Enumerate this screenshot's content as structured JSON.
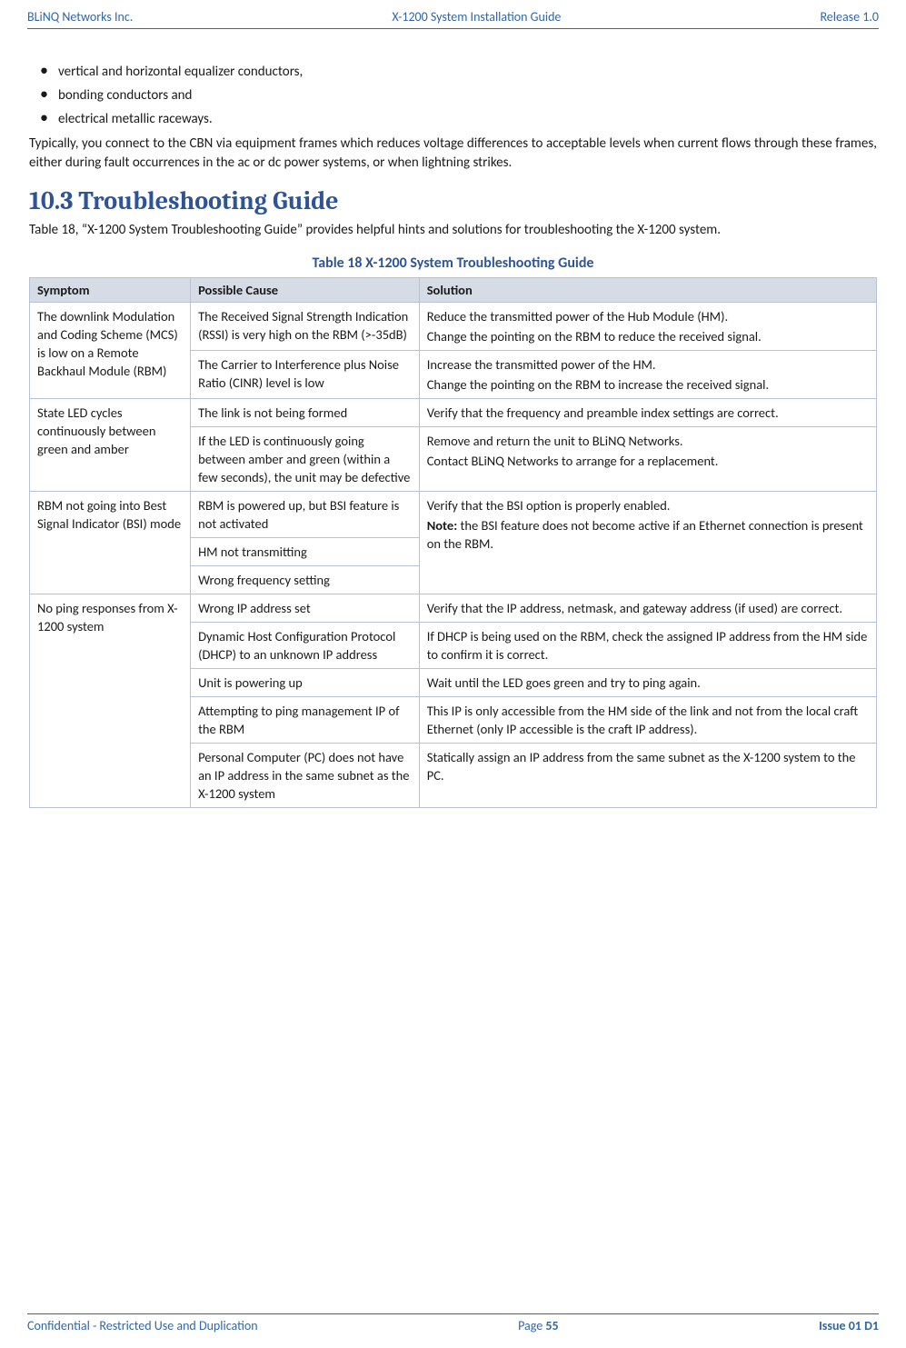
{
  "header": {
    "left": "BLiNQ Networks Inc.",
    "center": "X-1200 System Installation Guide",
    "right": "Release 1.0"
  },
  "bullets": [
    "vertical and horizontal equalizer conductors,",
    "bonding conductors and",
    "electrical metallic raceways."
  ],
  "para1": "Typically, you connect to the CBN via equipment frames which reduces voltage differences to acceptable levels when current flows through these frames, either during fault occurrences in the ac or dc power systems, or when lightning strikes.",
  "section": {
    "num": "10.3",
    "title": "Troubleshooting Guide"
  },
  "para2": "Table 18, “X-1200 System Troubleshooting Guide” provides helpful hints and solutions for troubleshooting the X-1200 system.",
  "caption": "Table 18   X-1200 System Troubleshooting Guide",
  "table": {
    "head": {
      "c1": "Symptom",
      "c2": "Possible Cause",
      "c3": "Solution"
    },
    "r0": {
      "sym": "The downlink Modulation and Coding Scheme (MCS) is low on a Remote Backhaul Module (RBM)",
      "cause": "The Received Signal Strength Indication (RSSI) is very high on the RBM (>-35dB)",
      "sol_a": "Reduce the transmitted power of the Hub Module (HM).",
      "sol_b": "Change the pointing on the RBM to reduce the received signal."
    },
    "r1": {
      "cause": "The Carrier to Interference plus Noise Ratio (CINR) level is low",
      "sol_a": "Increase the transmitted power of the HM.",
      "sol_b": "Change the pointing on the RBM to increase the received signal."
    },
    "r2": {
      "sym": "State LED cycles continuously between green and amber",
      "cause": "The link is not being formed",
      "sol": "Verify that the frequency and preamble index settings are correct."
    },
    "r3": {
      "cause": "If the LED is continuously going between amber and green (within a few seconds), the unit may be defective",
      "sol_a": "Remove and return the unit to BLiNQ Networks.",
      "sol_b": "Contact BLiNQ Networks to arrange for a replacement."
    },
    "r4": {
      "sym": "RBM not going into Best Signal Indicator (BSI) mode",
      "cause": "RBM is powered up, but BSI feature is not activated",
      "sol_a": "Verify that the BSI option is properly enabled.",
      "sol_b_pre": "Note:",
      "sol_b": " the BSI feature does not become active if an Ethernet connection is present on the RBM."
    },
    "r5": {
      "cause": "HM not transmitting"
    },
    "r6": {
      "cause": "Wrong frequency setting"
    },
    "r7": {
      "sym": "No ping responses from X-1200 system",
      "cause": "Wrong IP address set",
      "sol": "Verify that the IP address, netmask, and gateway address (if used) are correct."
    },
    "r8": {
      "cause": "Dynamic Host Configuration Protocol (DHCP) to an unknown IP address",
      "sol": "If DHCP is being used on the RBM, check the assigned IP address from the HM side to confirm it is correct."
    },
    "r9": {
      "cause": "Unit is powering up",
      "sol": "Wait until the LED goes green and try to ping again."
    },
    "r10": {
      "cause": "Attempting to ping management IP of the RBM",
      "sol": "This IP is only accessible from the HM side of the link and not from the local craft Ethernet (only IP accessible is the craft IP address)."
    },
    "r11": {
      "cause": "Personal Computer (PC) does not have an IP address in the same subnet as the X-1200 system",
      "sol": "Statically assign an IP address from the same subnet as the X-1200 system to the PC."
    }
  },
  "footer": {
    "left": "Confidential - Restricted Use and Duplication",
    "center_a": "Page ",
    "center_b": "55",
    "right": "Issue 01 D1"
  }
}
